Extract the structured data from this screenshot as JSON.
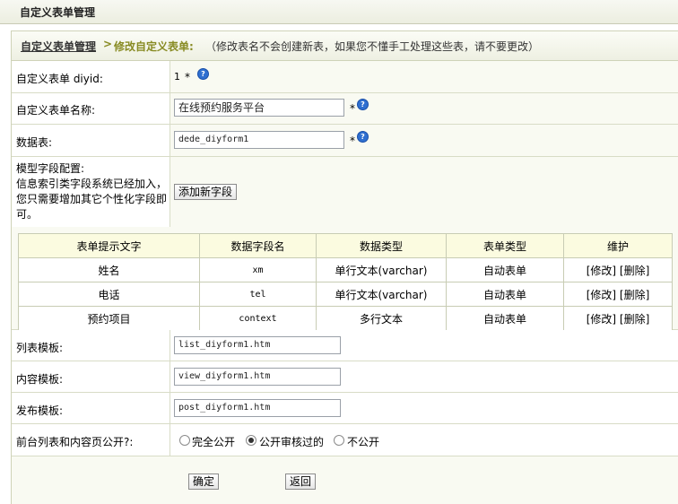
{
  "page_title": "自定义表单管理",
  "breadcrumb": {
    "root": "自定义表单管理",
    "separator": ">",
    "current": "修改自定义表单:",
    "note": "（修改表名不会创建新表，如果您不懂手工处理这些表，请不要更改）"
  },
  "form": {
    "diyid_label": "自定义表单 diyid:",
    "diyid_value": "1",
    "name_label": "自定义表单名称:",
    "name_value": "在线预约服务平台",
    "table_label": "数据表:",
    "table_value": "dede_diyform1",
    "required_mark": "*",
    "help_glyph": "?",
    "model_label_1": "模型字段配置:",
    "model_label_2": "信息索引类字段系统已经加入，",
    "model_label_3": "您只需要增加其它个性化字段即",
    "model_label_4": "可。",
    "add_field_button": "添加新字段",
    "list_tpl_label": "列表模板:",
    "list_tpl_value": "list_diyform1.htm",
    "view_tpl_label": "内容模板:",
    "view_tpl_value": "view_diyform1.htm",
    "post_tpl_label": "发布模板:",
    "post_tpl_value": "post_diyform1.htm",
    "public_label": "前台列表和内容页公开?:",
    "public_options": [
      "完全公开",
      "公开审核过的",
      "不公开"
    ],
    "public_selected": "公开审核过的",
    "ok_button": "确定",
    "back_button": "返回"
  },
  "fields_table": {
    "headers": [
      "表单提示文字",
      "数据字段名",
      "数据类型",
      "表单类型",
      "维护"
    ],
    "rows": [
      [
        "姓名",
        "xm",
        "单行文本(varchar)",
        "自动表单",
        "[修改] [删除]"
      ],
      [
        "电话",
        "tel",
        "单行文本(varchar)",
        "自动表单",
        "[修改] [删除]"
      ],
      [
        "预约项目",
        "context",
        "多行文本",
        "自动表单",
        "[修改] [删除]"
      ]
    ]
  }
}
